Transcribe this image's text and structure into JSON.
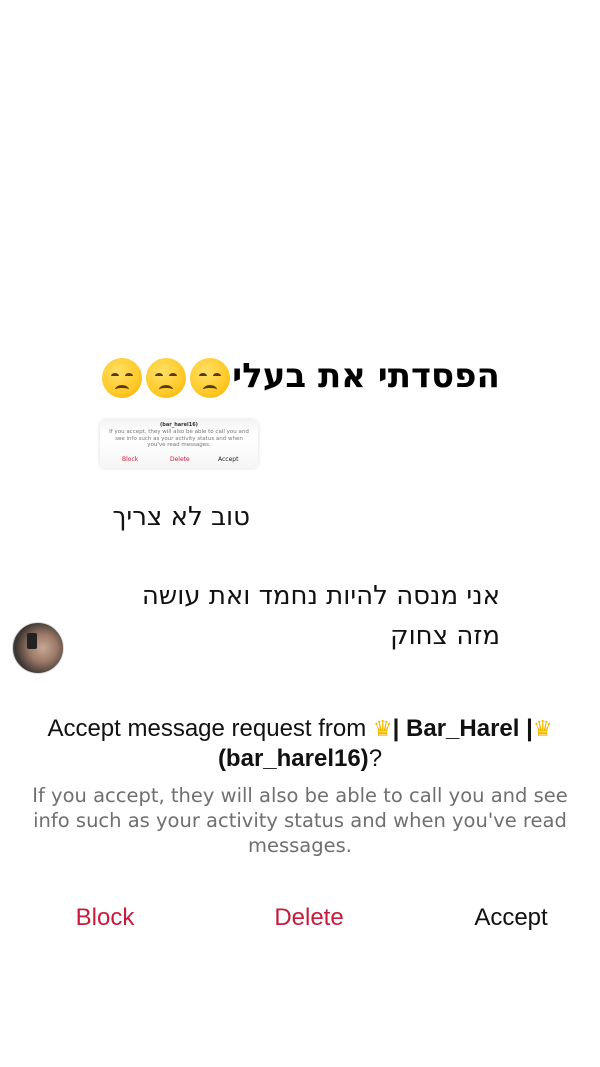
{
  "overlay": {
    "title": "הפסדתי את בעלי",
    "title_emoji": "disappointed-face-emoji",
    "title_emoji_count": 3
  },
  "thumbnail": {
    "head": "(bar_harel16)",
    "body": "If you accept, they will also be able to call you and see info such as your activity status and when you've read messages.",
    "block_label": "Block",
    "delete_label": "Delete",
    "accept_label": "Accept"
  },
  "messages": [
    {
      "text": "טוב לא צריך"
    },
    {
      "text": "אני מנסה להיות נחמד ואת עושה מזה צחוק"
    }
  ],
  "request": {
    "title_prefix": "Accept message request from ",
    "crown_icon": "crown-emoji",
    "display_name": "| Bar_Harel |",
    "username": "(bar_harel16)",
    "title_suffix": "?",
    "description": "If you accept, they will also be able to call you and see info such as your activity status and when you've read messages."
  },
  "actions": {
    "block_label": "Block",
    "delete_label": "Delete",
    "accept_label": "Accept"
  },
  "colors": {
    "destructive": "#c91a3b",
    "secondary_text": "#6f6f6f",
    "emoji_yellow": "#ffc928",
    "crown_gold": "#f5b700"
  }
}
